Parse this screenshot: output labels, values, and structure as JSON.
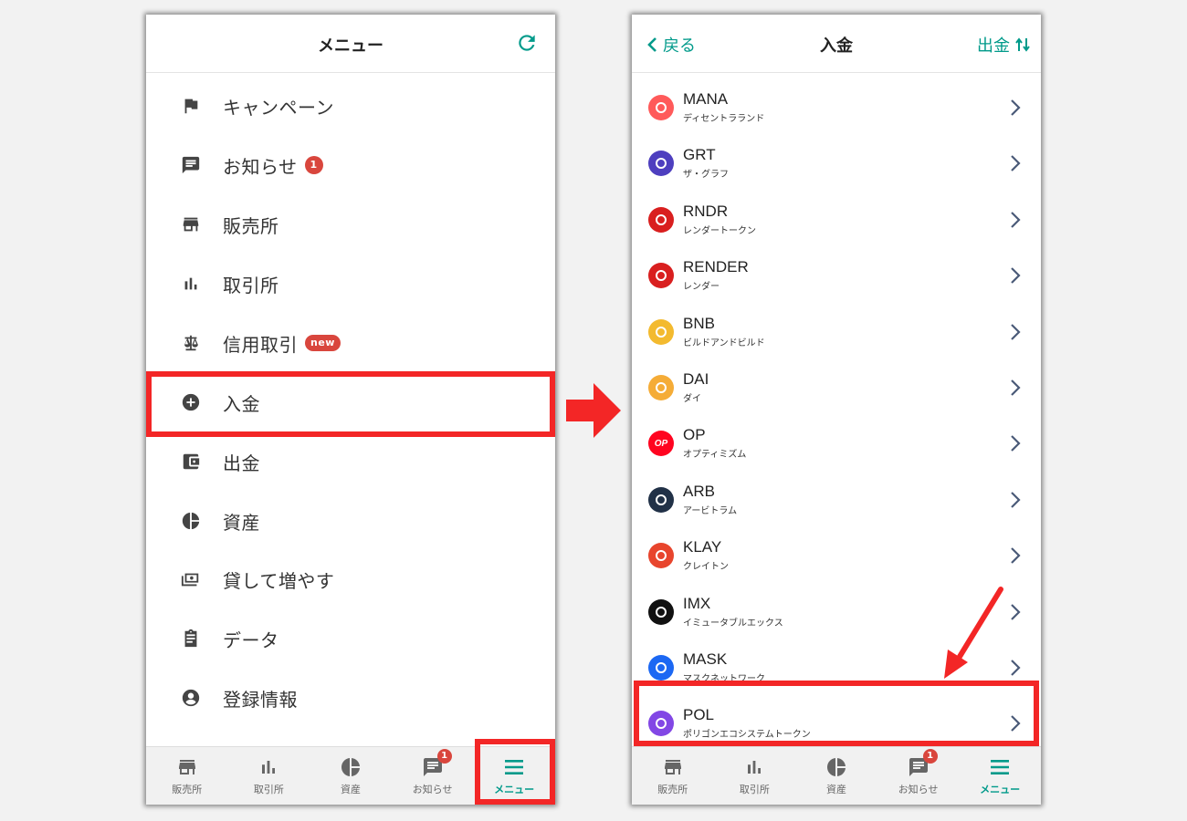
{
  "left_screen": {
    "title": "メニュー",
    "menu": [
      {
        "label": "キャンペーン",
        "icon": "flag-icon"
      },
      {
        "label": "お知らせ",
        "icon": "message-icon",
        "badge": "1"
      },
      {
        "label": "販売所",
        "icon": "store-icon"
      },
      {
        "label": "取引所",
        "icon": "bar-chart-icon"
      },
      {
        "label": "信用取引",
        "icon": "scale-icon",
        "badge": "new"
      },
      {
        "label": "入金",
        "icon": "plus-circle-icon"
      },
      {
        "label": "出金",
        "icon": "wallet-icon"
      },
      {
        "label": "資産",
        "icon": "pie-chart-icon"
      },
      {
        "label": "貸して増やす",
        "icon": "cash-icon"
      },
      {
        "label": "データ",
        "icon": "clipboard-icon"
      },
      {
        "label": "登録情報",
        "icon": "account-circle-icon"
      }
    ]
  },
  "right_screen": {
    "back_label": "戻る",
    "title": "入金",
    "withdraw_label": "出金",
    "coins": [
      {
        "symbol": "MANA",
        "name": "ディセントラランド",
        "color": "#ff5a5a"
      },
      {
        "symbol": "GRT",
        "name": "ザ・グラフ",
        "color": "#4e3fbf"
      },
      {
        "symbol": "RNDR",
        "name": "レンダートークン",
        "color": "#d91f1f"
      },
      {
        "symbol": "RENDER",
        "name": "レンダー",
        "color": "#d91f1f"
      },
      {
        "symbol": "BNB",
        "name": "ビルドアンドビルド",
        "color": "#f3ba2f"
      },
      {
        "symbol": "DAI",
        "name": "ダイ",
        "color": "#f5ac37"
      },
      {
        "symbol": "OP",
        "name": "オプティミズム",
        "color": "#ff0420",
        "icon_text": "OP"
      },
      {
        "symbol": "ARB",
        "name": "アービトラム",
        "color": "#213147"
      },
      {
        "symbol": "KLAY",
        "name": "クレイトン",
        "color": "#e8452d"
      },
      {
        "symbol": "IMX",
        "name": "イミュータブルエックス",
        "color": "#111111"
      },
      {
        "symbol": "MASK",
        "name": "マスクネットワーク",
        "color": "#1c68f3"
      },
      {
        "symbol": "POL",
        "name": "ポリゴンエコシステムトークン",
        "color": "#8247e5"
      }
    ]
  },
  "tabbar": {
    "tabs": [
      {
        "label": "販売所",
        "icon": "store-icon"
      },
      {
        "label": "取引所",
        "icon": "bar-chart-icon"
      },
      {
        "label": "資産",
        "icon": "pie-chart-icon"
      },
      {
        "label": "お知らせ",
        "icon": "message-icon",
        "badge": "1"
      },
      {
        "label": "メニュー",
        "icon": "hamburger-icon",
        "active": true
      }
    ]
  },
  "colors": {
    "accent": "#009a8a",
    "highlight": "#f32626",
    "badge": "#d9463d"
  }
}
